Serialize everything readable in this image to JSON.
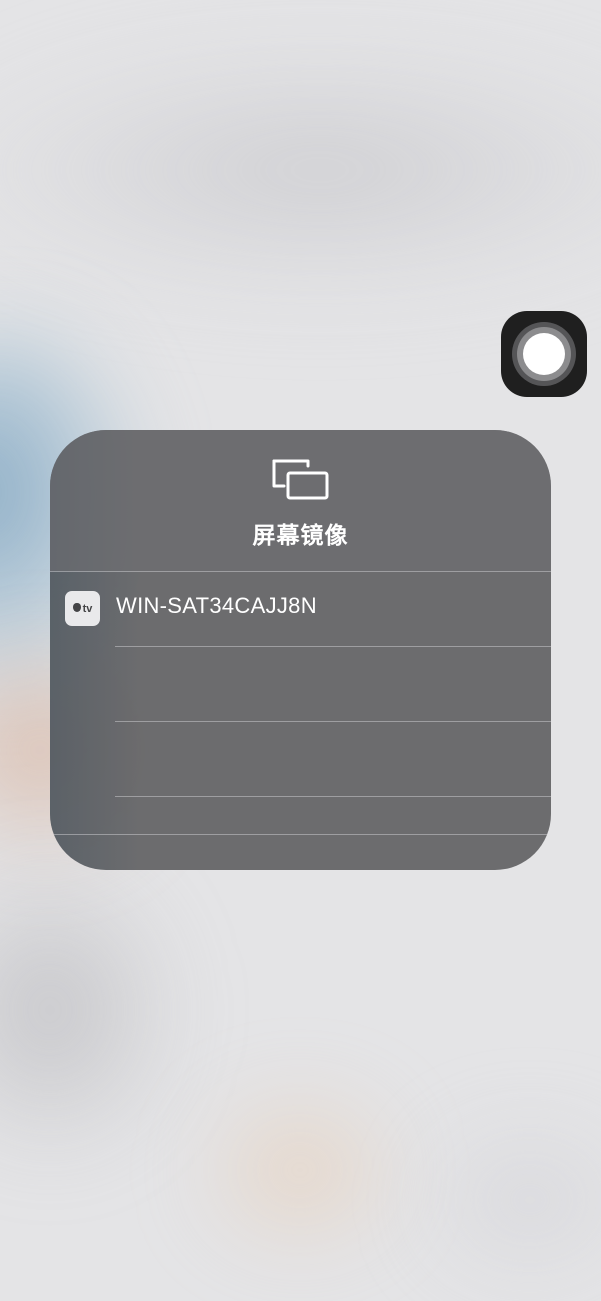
{
  "screen_mirroring": {
    "title": "屏幕镜像",
    "devices": [
      {
        "name": "WIN-SAT34CAJJ8N",
        "type_badge": "tv"
      }
    ]
  },
  "icons": {
    "header": "screen-mirroring-icon",
    "device": "apple-tv-icon",
    "floating": "assistive-touch-icon"
  },
  "colors": {
    "panel_bg": "#626264",
    "text": "#ffffff",
    "background": "#e4e4e6"
  }
}
